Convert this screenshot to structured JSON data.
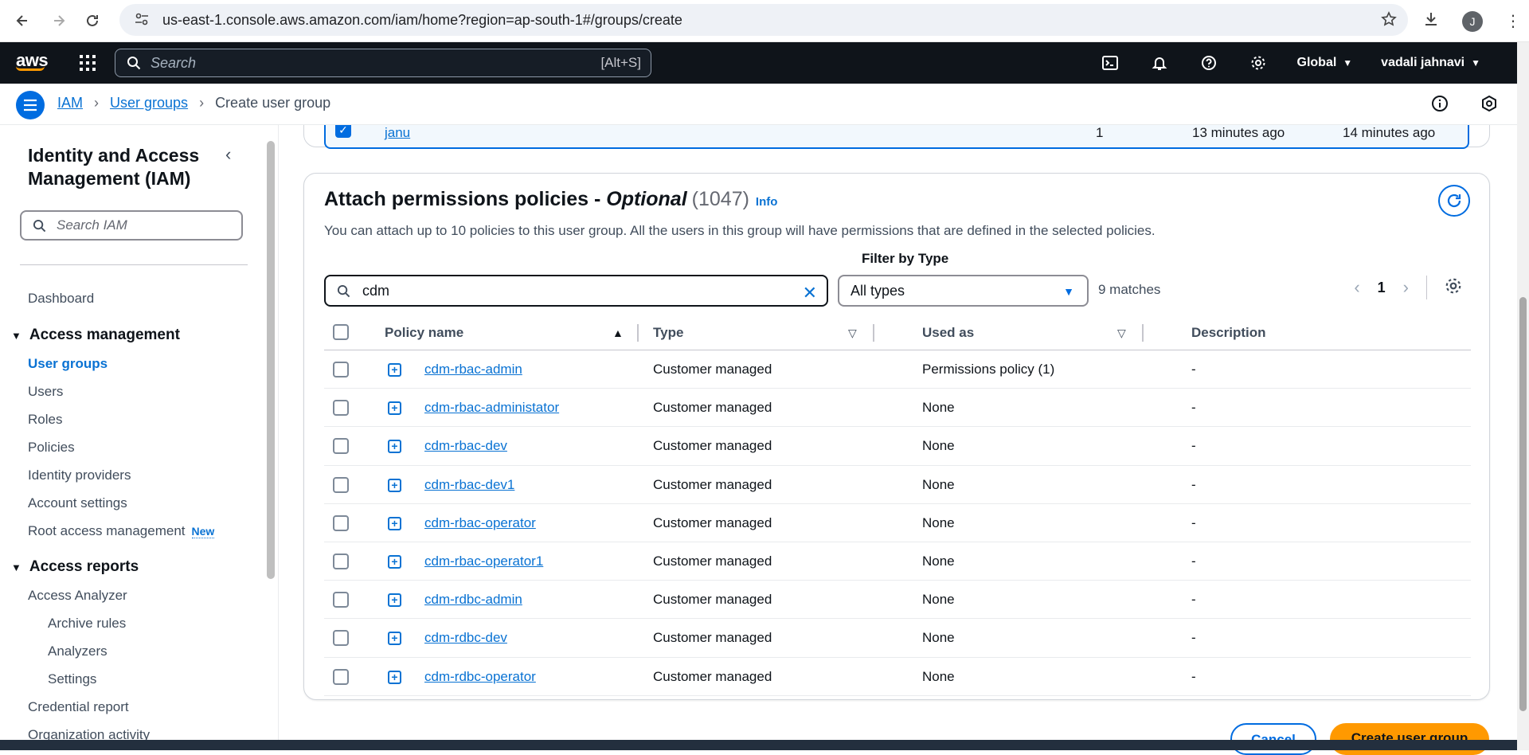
{
  "browser": {
    "url": "us-east-1.console.aws.amazon.com/iam/home?region=ap-south-1#/groups/create",
    "avatar_initial": "J"
  },
  "aws_nav": {
    "logo": "aws",
    "search_placeholder": "Search",
    "search_shortcut": "[Alt+S]",
    "region": "Global",
    "user": "vadali jahnavi"
  },
  "breadcrumb": {
    "items": [
      "IAM",
      "User groups"
    ],
    "current": "Create user group"
  },
  "sidebar": {
    "title": "Identity and Access Management (IAM)",
    "search_placeholder": "Search IAM",
    "dashboard": "Dashboard",
    "access_management": {
      "label": "Access management",
      "items": [
        "User groups",
        "Users",
        "Roles",
        "Policies",
        "Identity providers",
        "Account settings",
        "Root access management"
      ],
      "new_badge": "New"
    },
    "access_reports": {
      "label": "Access reports",
      "analyzer": "Access Analyzer",
      "sub_items": [
        "Archive rules",
        "Analyzers",
        "Settings"
      ],
      "credential_report": "Credential report",
      "org_activity": "Organization activity"
    }
  },
  "prev_user_row": {
    "name": "janu",
    "groups": "1",
    "last_activity": "13 minutes ago",
    "created": "14 minutes ago"
  },
  "policies_card": {
    "title_main": "Attach permissions policies - ",
    "title_optional": "Optional",
    "count": "(1047)",
    "info": "Info",
    "description": "You can attach up to 10 policies to this user group. All the users in this group will have permissions that are defined in the selected policies.",
    "search_value": "cdm",
    "filter_label": "Filter by Type",
    "filter_value": "All types",
    "matches": "9 matches",
    "page": "1",
    "columns": [
      "Policy name",
      "Type",
      "Used as",
      "Description"
    ],
    "rows": [
      {
        "name": "cdm-rbac-admin",
        "type": "Customer managed",
        "used_as": "Permissions policy (1)",
        "desc": "-"
      },
      {
        "name": "cdm-rbac-administator",
        "type": "Customer managed",
        "used_as": "None",
        "desc": "-"
      },
      {
        "name": "cdm-rbac-dev",
        "type": "Customer managed",
        "used_as": "None",
        "desc": "-"
      },
      {
        "name": "cdm-rbac-dev1",
        "type": "Customer managed",
        "used_as": "None",
        "desc": "-"
      },
      {
        "name": "cdm-rbac-operator",
        "type": "Customer managed",
        "used_as": "None",
        "desc": "-"
      },
      {
        "name": "cdm-rbac-operator1",
        "type": "Customer managed",
        "used_as": "None",
        "desc": "-"
      },
      {
        "name": "cdm-rdbc-admin",
        "type": "Customer managed",
        "used_as": "None",
        "desc": "-"
      },
      {
        "name": "cdm-rdbc-dev",
        "type": "Customer managed",
        "used_as": "None",
        "desc": "-"
      },
      {
        "name": "cdm-rdbc-operator",
        "type": "Customer managed",
        "used_as": "None",
        "desc": "-"
      }
    ]
  },
  "footer": {
    "cancel": "Cancel",
    "create": "Create user group"
  },
  "colors": {
    "aws_dark": "#0f141a",
    "link_blue": "#0972d3",
    "primary_orange": "#ff9900"
  }
}
